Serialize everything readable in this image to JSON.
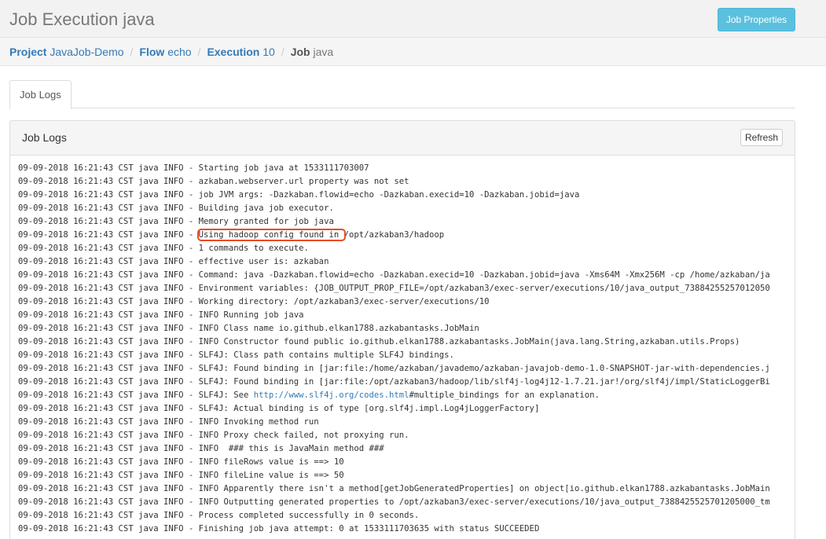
{
  "header": {
    "title": "Job Execution java",
    "job_properties_label": "Job Properties"
  },
  "breadcrumb": {
    "items": [
      {
        "key": "Project",
        "value": "JavaJob-Demo"
      },
      {
        "key": "Flow",
        "value": "echo"
      },
      {
        "key": "Execution",
        "value": "10"
      },
      {
        "key": "Job",
        "value": "java"
      }
    ],
    "separator": "/"
  },
  "tabs": [
    {
      "label": "Job Logs"
    }
  ],
  "panel": {
    "title": "Job Logs",
    "refresh_label": "Refresh"
  },
  "log": {
    "prefix": "09-09-2018 16:21:43 CST java ",
    "lines": [
      "INFO - Starting job java at 1533111703007",
      "INFO - azkaban.webserver.url property was not set",
      "INFO - job JVM args: -Dazkaban.flowid=echo -Dazkaban.execid=10 -Dazkaban.jobid=java",
      "INFO - Building java job executor.",
      "INFO - Memory granted for job java",
      "INFO - Using hadoop config found in /opt/azkaban3/hadoop",
      "INFO - 1 commands to execute.",
      "INFO - effective user is: azkaban",
      "INFO - Command: java -Dazkaban.flowid=echo -Dazkaban.execid=10 -Dazkaban.jobid=java -Xms64M -Xmx256M -cp /home/azkaban/ja",
      "INFO - Environment variables: {JOB_OUTPUT_PROP_FILE=/opt/azkaban3/exec-server/executions/10/java_output_73884255257012050",
      "INFO - Working directory: /opt/azkaban3/exec-server/executions/10",
      "INFO - INFO Running job java",
      "INFO - INFO Class name io.github.elkan1788.azkabantasks.JobMain",
      "INFO - INFO Constructor found public io.github.elkan1788.azkabantasks.JobMain(java.lang.String,azkaban.utils.Props)",
      "INFO - SLF4J: Class path contains multiple SLF4J bindings.",
      "INFO - SLF4J: Found binding in [jar:file:/home/azkaban/javademo/azkaban-javajob-demo-1.0-SNAPSHOT-jar-with-dependencies.j",
      "INFO - SLF4J: Found binding in [jar:file:/opt/azkaban3/hadoop/lib/slf4j-log4j12-1.7.21.jar!/org/slf4j/impl/StaticLoggerBi",
      "INFO - SLF4J: See http://www.slf4j.org/codes.html#multiple_bindings for an explanation.",
      "INFO - SLF4J: Actual binding is of type [org.slf4j.impl.Log4jLoggerFactory]",
      "INFO - INFO Invoking method run",
      "INFO - INFO Proxy check failed, not proxying run.",
      "INFO - INFO  ### this is JavaMain method ###",
      "INFO - INFO fileRows value is ==> 10",
      "INFO - INFO fileLine value is ==> 50",
      "INFO - INFO Apparently there isn't a method[getJobGeneratedProperties] on object[io.github.elkan1788.azkabantasks.JobMain",
      "INFO - INFO Outputting generated properties to /opt/azkaban3/exec-server/executions/10/java_output_7388425525701205000_tm",
      "INFO - Process completed successfully in 0 seconds.",
      "INFO - Finishing job java attempt: 0 at 1533111703635 with status SUCCEEDED"
    ],
    "highlight": {
      "line": 5,
      "text": "Using hadoop config found in "
    },
    "link": {
      "line": 17,
      "text": "http://www.slf4j.org/codes.html"
    }
  }
}
